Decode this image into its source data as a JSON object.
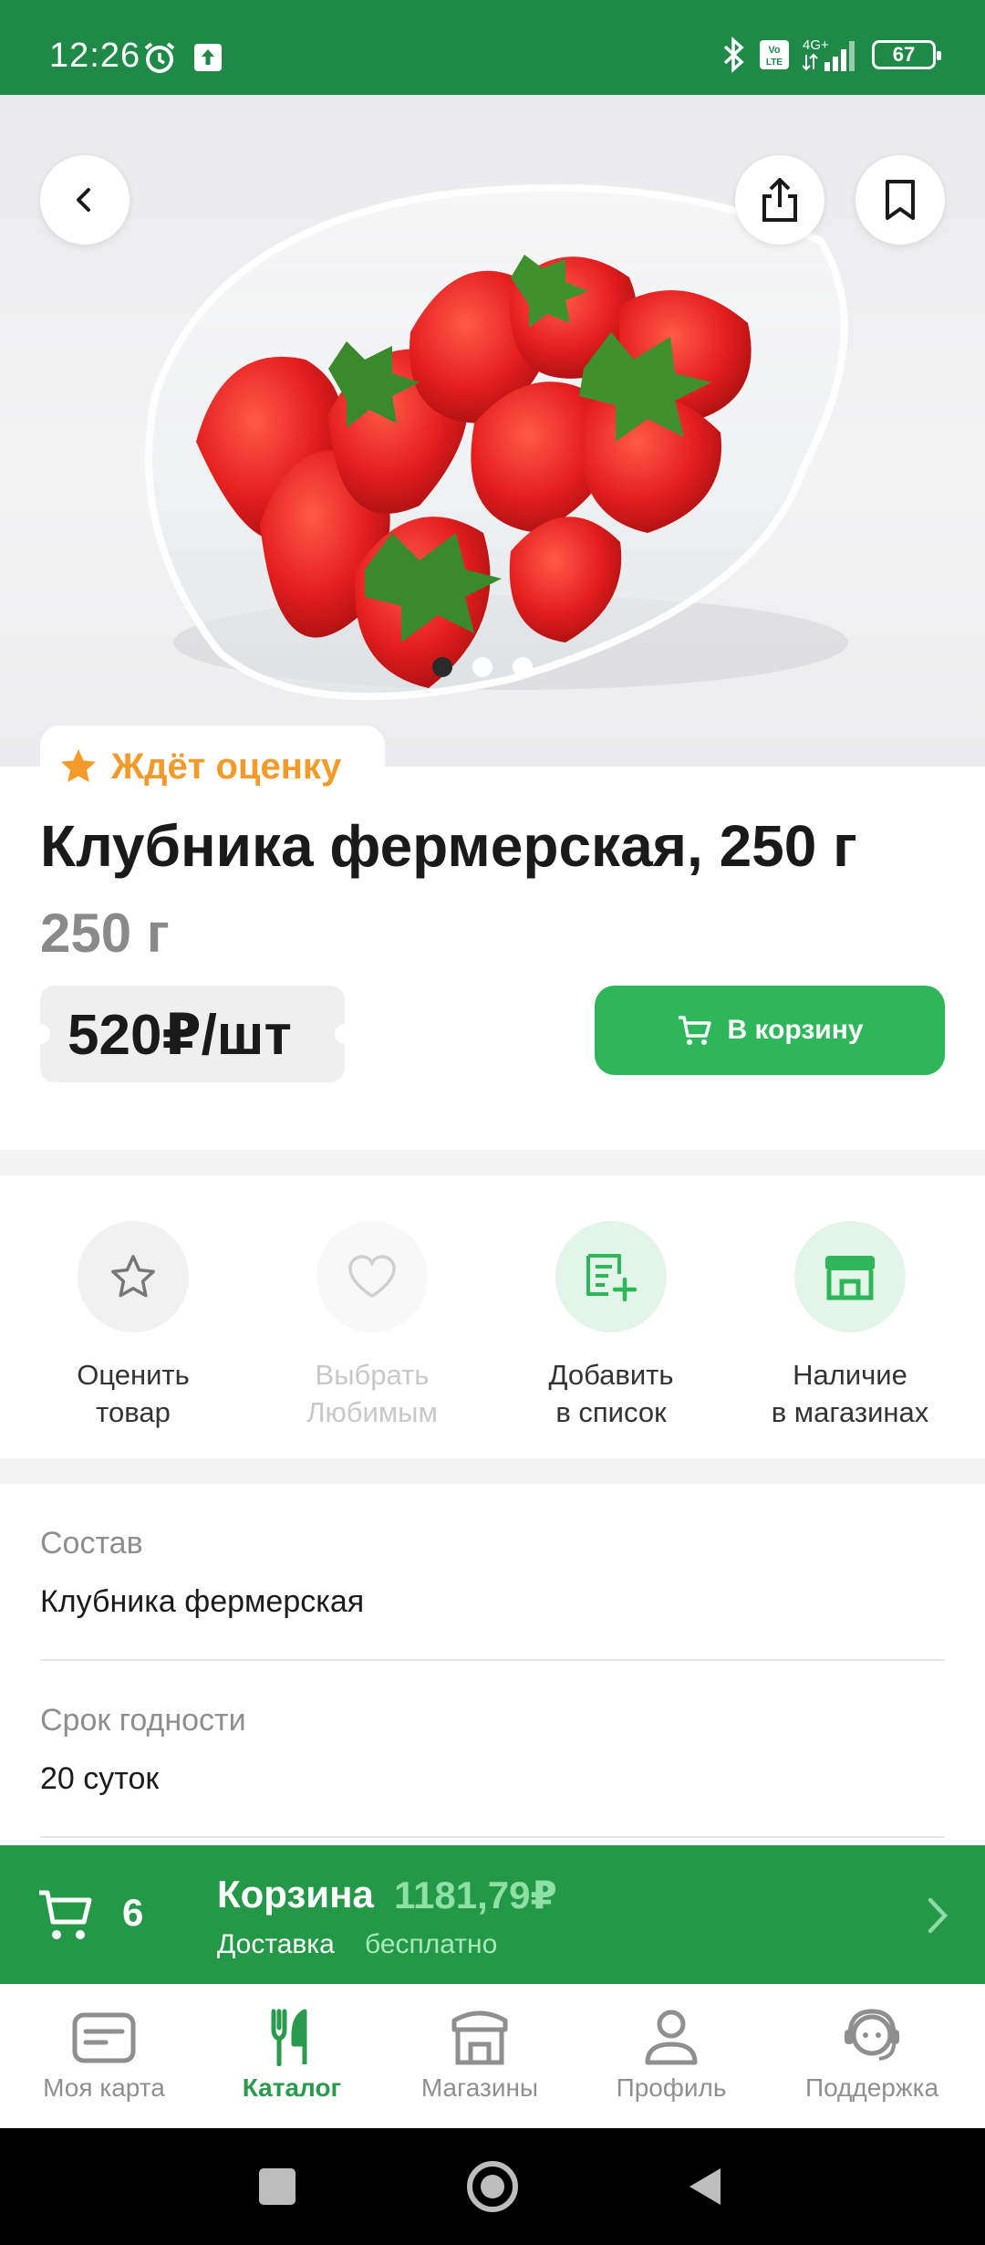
{
  "status_bar": {
    "time": "12:26",
    "battery": "67",
    "network": "4G+"
  },
  "hero": {
    "image_alt": "strawberries",
    "slides": 3,
    "active_slide": 0
  },
  "rating": {
    "label": "Ждёт оценку"
  },
  "product": {
    "title": "Клубника фермерская, 250 г",
    "weight": "250 г",
    "price": "520₽/шт",
    "cart_button": "В корзину"
  },
  "actions": [
    {
      "line1": "Оценить",
      "line2": "товар"
    },
    {
      "line1": "Выбрать",
      "line2": "Любимым"
    },
    {
      "line1": "Добавить",
      "line2": "в список"
    },
    {
      "line1": "Наличие",
      "line2": "в магазинах"
    }
  ],
  "details": {
    "composition_label": "Состав",
    "composition_value": "Клубника фермерская",
    "shelf_label": "Срок годности",
    "shelf_value": "20 суток"
  },
  "basket": {
    "count": "6",
    "title": "Корзина",
    "sum": "1181,79₽",
    "delivery_label": "Доставка",
    "delivery_value": "бесплатно"
  },
  "nav": [
    {
      "label": "Моя карта"
    },
    {
      "label": "Каталог"
    },
    {
      "label": "Магазины"
    },
    {
      "label": "Профиль"
    },
    {
      "label": "Поддержка"
    }
  ],
  "colors": {
    "brand": "#1f8a48",
    "accent": "#2fb65a",
    "rating": "#f39a2a"
  }
}
